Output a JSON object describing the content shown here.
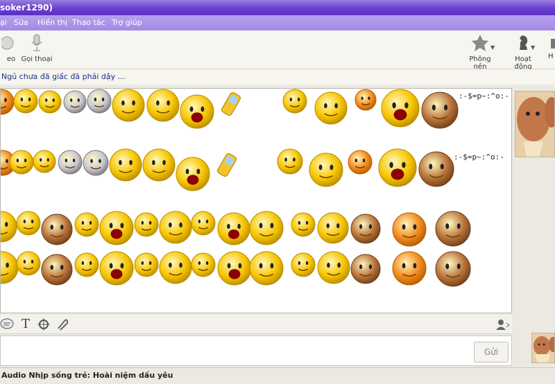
{
  "window": {
    "title": "soker1290)"
  },
  "menu": [
    "ại",
    "Sửa",
    "Hiển thị",
    "Thao tác",
    "Trợ giúp"
  ],
  "toolbar": {
    "left": [
      {
        "label": "eo",
        "icon": "webcam-icon"
      },
      {
        "label": "Gọi thoại",
        "icon": "microphone-icon"
      }
    ],
    "right": [
      {
        "label": "Phông nền",
        "icon": "background-icon"
      },
      {
        "label": "Hoạt động",
        "icon": "chess-knight-icon"
      },
      {
        "label": "H",
        "icon": "more-icon"
      }
    ]
  },
  "status_message": "Ngủ chưa đã giấc đã phải dậy ...",
  "chat": {
    "text_line_1": ":-$=p~:^o:-",
    "text_line_2": ":-$=p~:^o:-"
  },
  "send_label": "Gửi",
  "bottom_status": "Audio Nhịp sống trẻ: Hoài niệm dấu yêu",
  "colors": {
    "titlebar": "#6b3fd0",
    "menubar": "#a389e6",
    "status_text": "#1a2f8f",
    "emoticon_yellow": "#f7c600",
    "emoticon_orange": "#f28a1b"
  }
}
